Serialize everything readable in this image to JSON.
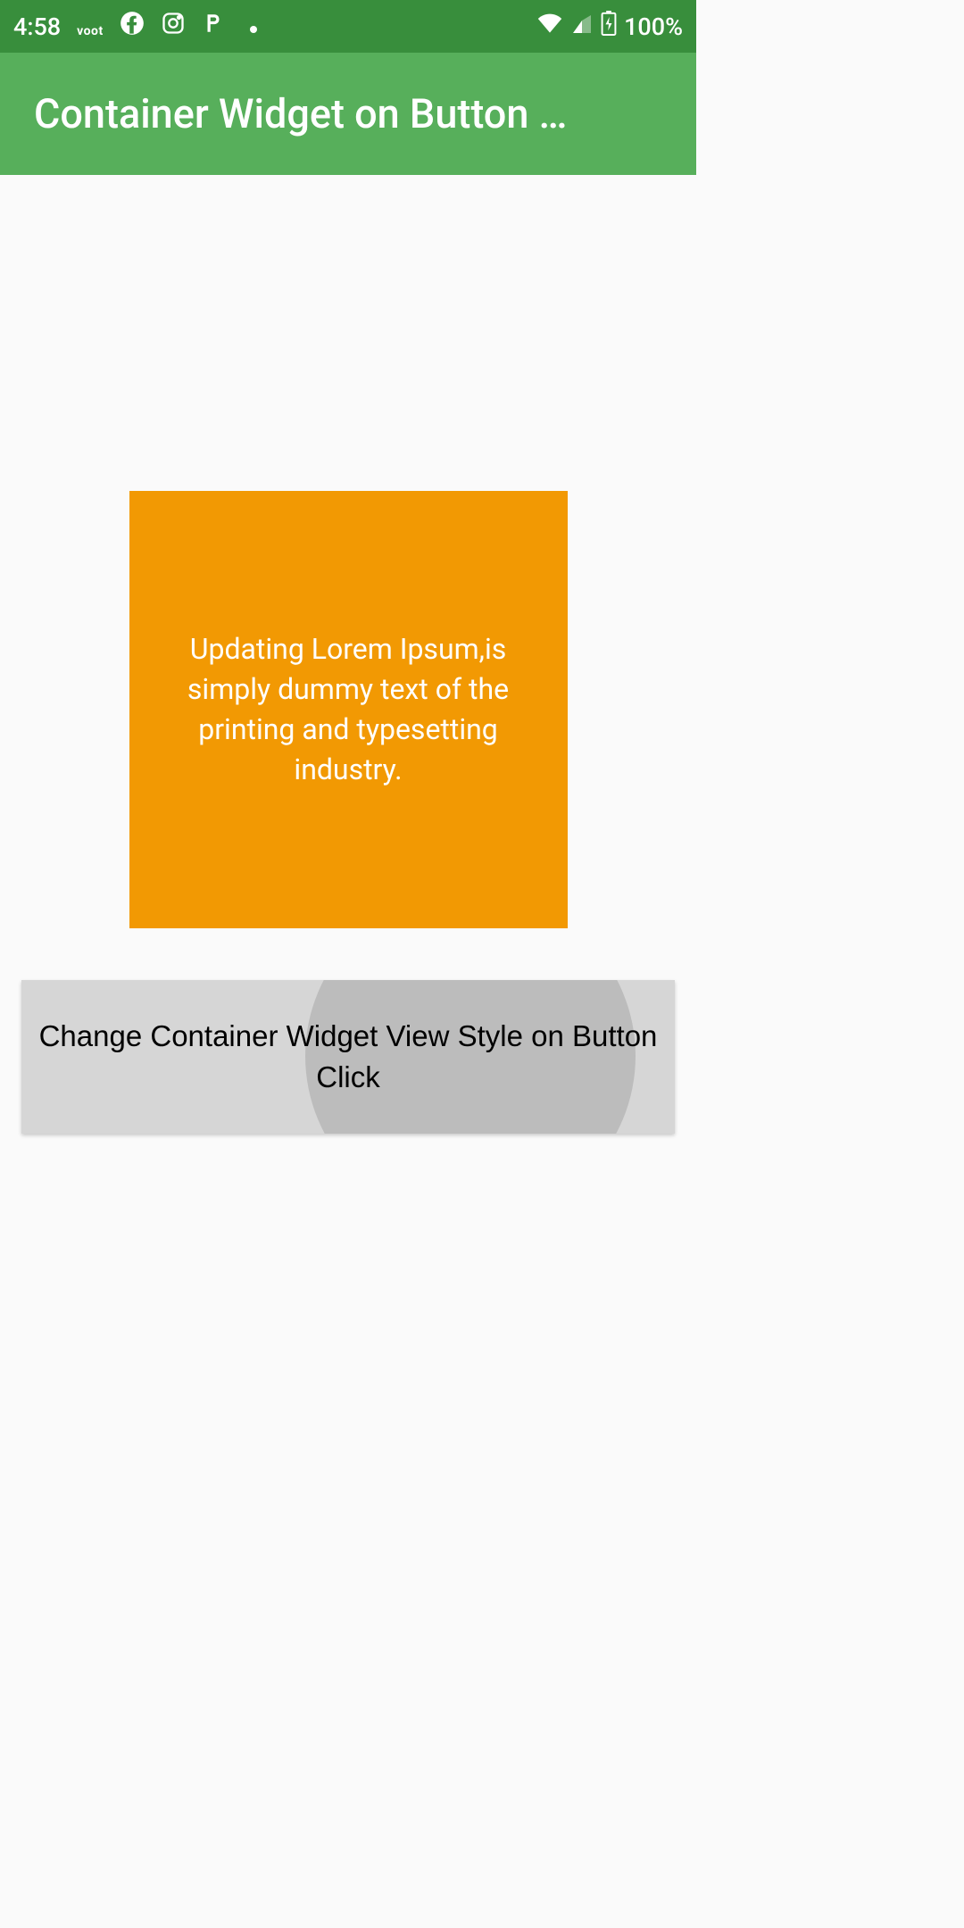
{
  "status": {
    "time": "4:58",
    "voot": "voot",
    "battery": "100%"
  },
  "appbar": {
    "title": "Container Widget on Button …"
  },
  "container": {
    "text": "Updating Lorem Ipsum,is simply dummy text of the printing and typesetting industry."
  },
  "button": {
    "label": "Change Container Widget View Style on Button Click"
  }
}
